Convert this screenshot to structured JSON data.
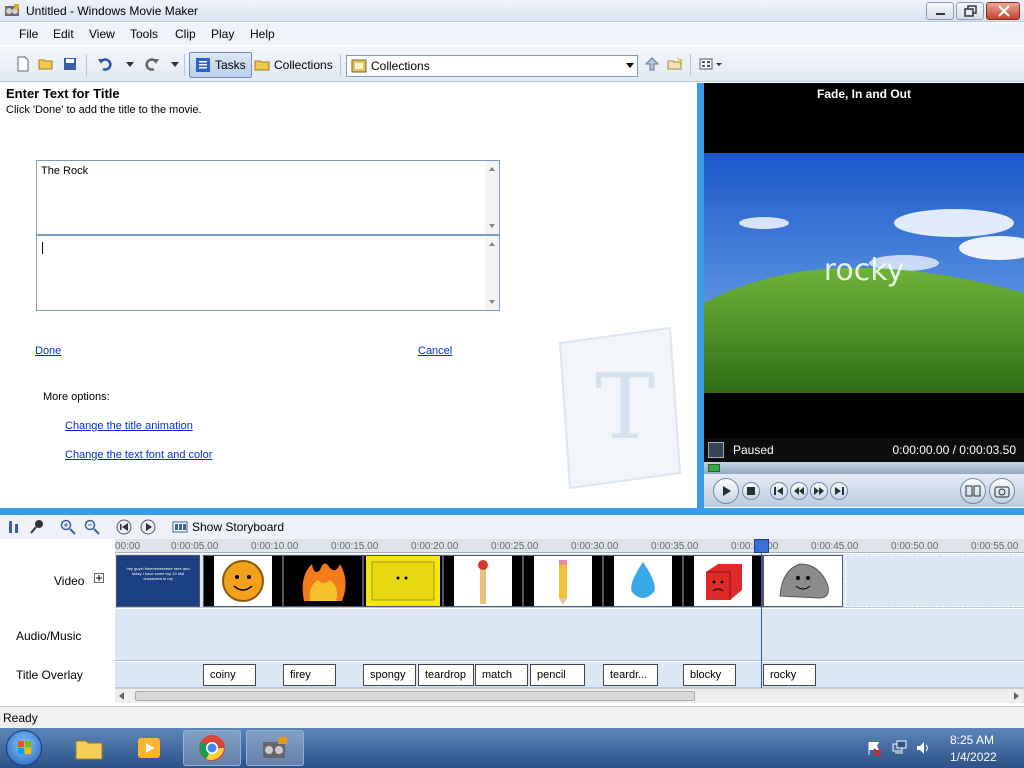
{
  "window": {
    "title": "Untitled - Windows Movie Maker"
  },
  "menu": [
    "File",
    "Edit",
    "View",
    "Tools",
    "Clip",
    "Play",
    "Help"
  ],
  "toolbar": {
    "tasks_label": "Tasks",
    "collections_label": "Collections",
    "collections_combo_value": "Collections"
  },
  "taskpane": {
    "heading": "Enter Text for Title",
    "instruction": "Click 'Done' to add the title to the movie.",
    "title_text_1": "The Rock",
    "title_text_2": "",
    "done_label": "Done",
    "cancel_label": "Cancel",
    "more_options": "More options:",
    "change_animation": "Change the title animation",
    "change_font": "Change the text font and color",
    "watermark_letter": "T"
  },
  "preview": {
    "caption": "Fade, In and Out",
    "overlay_text": "rocky",
    "status": "Paused",
    "time": "0:00:00.00 / 0:00:03.50",
    "progress": 0.0
  },
  "timeline_toolbar": {
    "show_storyboard": "Show Storyboard"
  },
  "timeline": {
    "tracks": {
      "video": "Video",
      "audio": "Audio/Music",
      "title": "Title Overlay"
    },
    "ruler": [
      "00:00",
      "0:00:05.00",
      "0:00:10.00",
      "0:00:15.00",
      "0:00:20.00",
      "0:00:25.00",
      "0:00:30.00",
      "0:00:35.00",
      "0:00:40.00",
      "0:00:45.00",
      "0:00:50.00",
      "0:00:55.00"
    ],
    "first_clip_text": "hey guys! theeeeeeeeeee here and today I have some top 10 bfdi characters in my",
    "title_clips": [
      "coiny",
      "firey",
      "spongy",
      "teardrop",
      "match",
      "pencil",
      "teardr...",
      "blocky",
      "rocky"
    ]
  },
  "statusbar": {
    "text": "Ready"
  },
  "clock": {
    "time": "8:25 AM",
    "date": "1/4/2022"
  },
  "colors": {
    "accent": "#3a9ce8",
    "link": "#0033cc"
  }
}
